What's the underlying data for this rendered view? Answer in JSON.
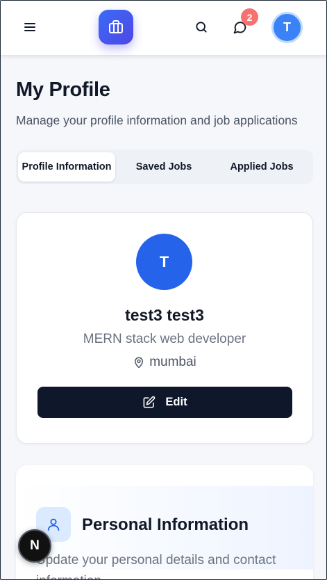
{
  "header": {
    "notification_count": "2",
    "user_initial": "T",
    "icons": {
      "menu": "menu-icon",
      "brand": "briefcase-icon",
      "search": "search-icon",
      "messages": "message-circle-icon"
    }
  },
  "page": {
    "title": "My Profile",
    "subtitle": "Manage your profile information and job applications"
  },
  "tabs": [
    {
      "label": "Profile Information",
      "active": true
    },
    {
      "label": "Saved Jobs",
      "active": false
    },
    {
      "label": "Applied Jobs",
      "active": false
    }
  ],
  "profile": {
    "initial": "T",
    "name": "test3 test3",
    "role": "MERN stack web developer",
    "location": "mumbai",
    "edit_label": "Edit"
  },
  "personal_info": {
    "title": "Personal Information",
    "description": "Update your personal details and contact information"
  },
  "floating_button": {
    "label": "N"
  },
  "colors": {
    "brand": "#4f46e5",
    "primary": "#2563eb",
    "avatar_top": "#3b82f6",
    "badge": "#f87171",
    "dark_button": "#0f172a"
  }
}
